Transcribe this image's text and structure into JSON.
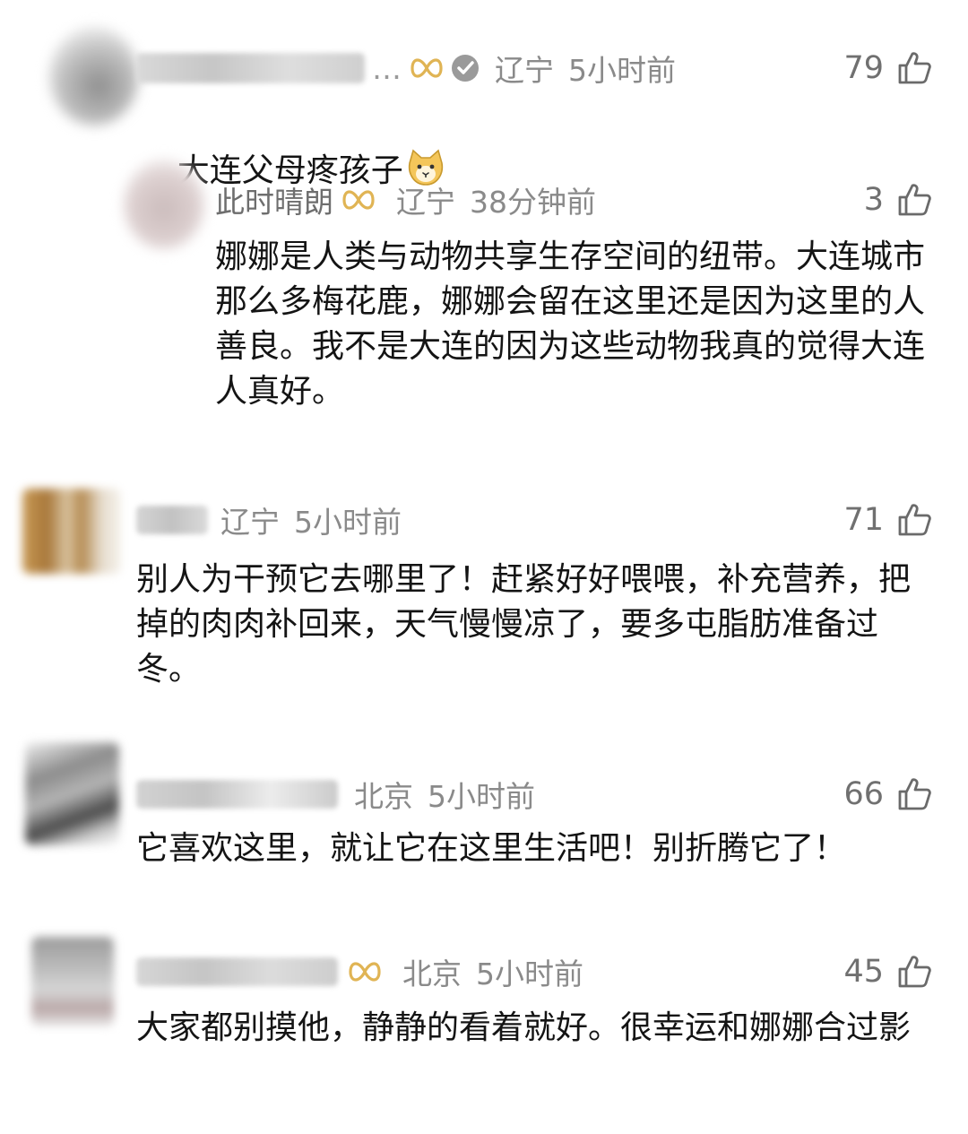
{
  "comments": [
    {
      "username": "…",
      "location": "辽宁",
      "time": "5小时前",
      "likes": "79",
      "text": "大连父母疼孩子",
      "emoji": "cat-face-icon",
      "replies": [
        {
          "username": "此时晴朗",
          "location": "辽宁",
          "time": "38分钟前",
          "likes": "3",
          "text": "娜娜是人类与动物共享生存空间的纽带。大连城市那么多梅花鹿，娜娜会留在这里还是因为这里的人善良。我不是大连的因为这些动物我真的觉得大连人真好。"
        }
      ]
    },
    {
      "username": "",
      "location": "辽宁",
      "time": "5小时前",
      "likes": "71",
      "text": "别人为干预它去哪里了！赶紧好好喂喂，补充营养，把掉的肉肉补回来，天气慢慢凉了，要多屯脂肪准备过冬。"
    },
    {
      "username": "",
      "location": "北京",
      "time": "5小时前",
      "likes": "66",
      "text": "它喜欢这里，就让它在这里生活吧！别折腾它了！"
    },
    {
      "username": "",
      "location": "北京",
      "time": "5小时前",
      "likes": "45",
      "text": "大家都别摸他，静静的看着就好。很幸运和娜娜合过影"
    }
  ],
  "colors": {
    "meta": "#8a8a8a",
    "text": "#141414",
    "badge_gold": "#e0b454"
  }
}
